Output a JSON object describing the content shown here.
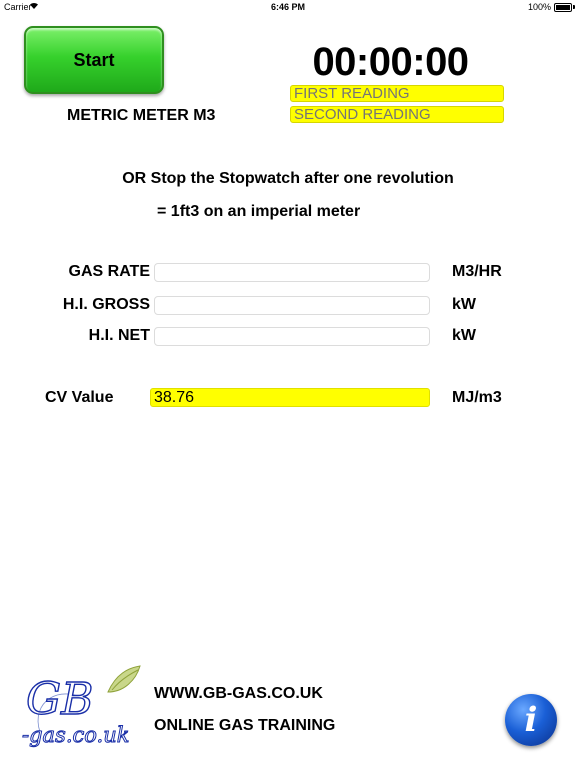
{
  "status_bar": {
    "carrier": "Carrier",
    "time": "6:46 PM",
    "battery": "100%"
  },
  "start_button": {
    "label": "Start"
  },
  "timer": {
    "display": "00:00:00"
  },
  "meter": {
    "type_label": "METRIC METER M3"
  },
  "readings": {
    "first_placeholder": "FIRST READING",
    "second_placeholder": "SECOND READING",
    "highlight_color": "#ffff00"
  },
  "instructions": {
    "line1": "OR Stop the Stopwatch after one revolution",
    "line2": "= 1ft3 on an imperial meter"
  },
  "results": {
    "gas_rate": {
      "label": "GAS RATE",
      "value": "",
      "unit": "M3/HR"
    },
    "hi_gross": {
      "label": "H.I. GROSS",
      "value": "",
      "unit": "kW"
    },
    "hi_net": {
      "label": "H.I. NET",
      "value": "",
      "unit": "kW"
    }
  },
  "cv": {
    "label": "CV Value",
    "value": "38.76",
    "unit": "MJ/m3"
  },
  "footer": {
    "logo_text_top": "GB",
    "logo_text_bottom": "-gas.co.uk",
    "website": "WWW.GB-GAS.CO.UK",
    "tagline": "ONLINE GAS TRAINING",
    "info_icon": "info-icon"
  }
}
